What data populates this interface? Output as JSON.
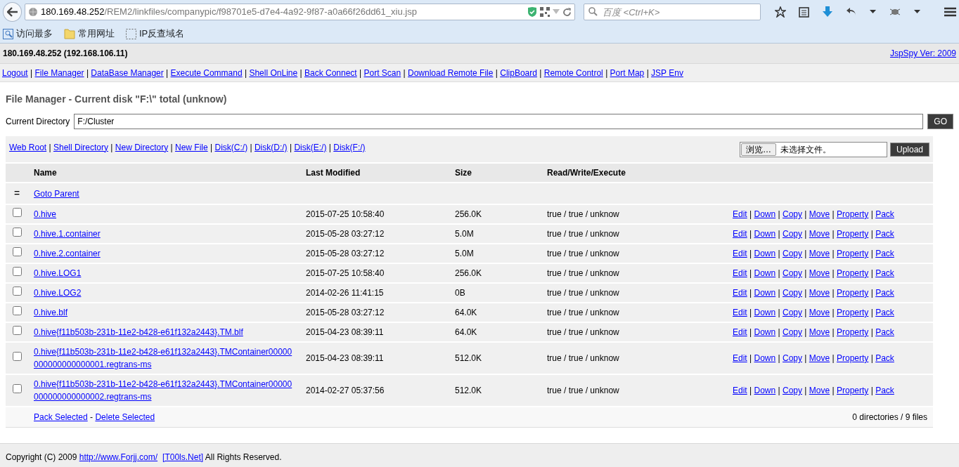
{
  "browser": {
    "url_host": "180.169.48.252",
    "url_path": "/REM2/linkfiles/companypic/f98701e5-d7e4-4a92-9f87-a0a66f26dd61_xiu.jsp",
    "search_placeholder": "百度 <Ctrl+K>",
    "bookmarks": [
      {
        "label": "访问最多",
        "kind": "recent"
      },
      {
        "label": "常用网址",
        "kind": "folder"
      },
      {
        "label": "IP反查域名",
        "kind": "page"
      }
    ]
  },
  "header": {
    "host": "180.169.48.252 (192.168.106.11)",
    "version": "JspSpy Ver: 2009"
  },
  "nav": {
    "separator": "|",
    "links": [
      "Logout",
      "File Manager",
      "DataBase Manager",
      "Execute Command",
      "Shell OnLine",
      "Back Connect",
      "Port Scan",
      "Download Remote File",
      "ClipBoard",
      "Remote Control",
      "Port Map",
      "JSP Env"
    ]
  },
  "title": "File Manager - Current disk \"F:\\\" total (unknow)",
  "current_directory": {
    "label": "Current Directory",
    "value": "F:/Cluster",
    "button": "GO"
  },
  "quick_links": {
    "separator": "|",
    "links": [
      "Web Root",
      "Shell Directory",
      "New Directory",
      "New File",
      "Disk(C:/)",
      "Disk(D:/)",
      "Disk(E:/)",
      "Disk(F:/)"
    ]
  },
  "upload": {
    "browse_button": "浏览…",
    "no_file_text": "未选择文件。",
    "button": "Upload"
  },
  "table": {
    "columns": [
      "Name",
      "Last Modified",
      "Size",
      "Read/Write/Execute"
    ],
    "parent": {
      "symbol": "=",
      "link": "Goto Parent"
    },
    "action_separator": "|",
    "rows": [
      {
        "name": "0.hive",
        "modified": "2015-07-25 10:58:40",
        "size": "256.0K",
        "rwx": "true / true / unknow",
        "checked": false,
        "actions": [
          "Edit",
          "Down",
          "Copy",
          "Move",
          "Property",
          "Pack"
        ]
      },
      {
        "name": "0.hive.1.container",
        "modified": "2015-05-28 03:27:12",
        "size": "5.0M",
        "rwx": "true / true / unknow",
        "checked": false,
        "actions": [
          "Edit",
          "Down",
          "Copy",
          "Move",
          "Property",
          "Pack"
        ]
      },
      {
        "name": "0.hive.2.container",
        "modified": "2015-05-28 03:27:12",
        "size": "5.0M",
        "rwx": "true / true / unknow",
        "checked": false,
        "actions": [
          "Edit",
          "Down",
          "Copy",
          "Move",
          "Property",
          "Pack"
        ]
      },
      {
        "name": "0.hive.LOG1",
        "modified": "2015-07-25 10:58:40",
        "size": "256.0K",
        "rwx": "true / true / unknow",
        "checked": false,
        "actions": [
          "Edit",
          "Down",
          "Copy",
          "Move",
          "Property",
          "Pack"
        ]
      },
      {
        "name": "0.hive.LOG2",
        "modified": "2014-02-26 11:41:15",
        "size": "0B",
        "rwx": "true / true / unknow",
        "checked": false,
        "actions": [
          "Edit",
          "Down",
          "Copy",
          "Move",
          "Property",
          "Pack"
        ]
      },
      {
        "name": "0.hive.blf",
        "modified": "2015-05-28 03:27:12",
        "size": "64.0K",
        "rwx": "true / true / unknow",
        "checked": false,
        "actions": [
          "Edit",
          "Down",
          "Copy",
          "Move",
          "Property",
          "Pack"
        ]
      },
      {
        "name": "0.hive{f11b503b-231b-11e2-b428-e61f132a2443}.TM.blf",
        "modified": "2015-04-23 08:39:11",
        "size": "64.0K",
        "rwx": "true / true / unknow",
        "checked": false,
        "actions": [
          "Edit",
          "Down",
          "Copy",
          "Move",
          "Property",
          "Pack"
        ]
      },
      {
        "name": "0.hive{f11b503b-231b-11e2-b428-e61f132a2443}.TMContainer00000000000000000001.regtrans-ms",
        "modified": "2015-04-23 08:39:11",
        "size": "512.0K",
        "rwx": "true / true / unknow",
        "checked": false,
        "actions": [
          "Edit",
          "Down",
          "Copy",
          "Move",
          "Property",
          "Pack"
        ]
      },
      {
        "name": "0.hive{f11b503b-231b-11e2-b428-e61f132a2443}.TMContainer00000000000000000002.regtrans-ms",
        "modified": "2014-02-27 05:37:56",
        "size": "512.0K",
        "rwx": "true / true / unknow",
        "checked": false,
        "actions": [
          "Edit",
          "Down",
          "Copy",
          "Move",
          "Property",
          "Pack"
        ]
      }
    ],
    "footer": {
      "separator": "-",
      "links": [
        "Pack Selected",
        "Delete Selected"
      ],
      "summary": "0 directories / 9 files"
    }
  },
  "copyright": [
    {
      "kind": "text",
      "text": "Copyright (C) 2009 "
    },
    {
      "kind": "link",
      "text": "http://www.Forjj.com/"
    },
    {
      "kind": "link",
      "text": "[T00ls.Net]"
    },
    {
      "kind": "text",
      "text": " All Rights Reserved."
    }
  ]
}
